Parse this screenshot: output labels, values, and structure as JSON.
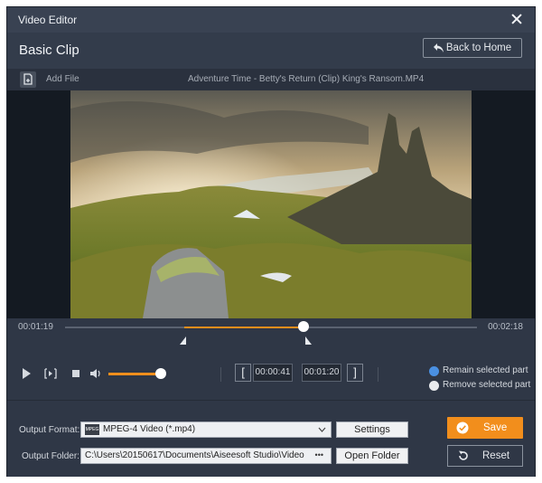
{
  "window": {
    "title": "Video Editor"
  },
  "header": {
    "title": "Basic Clip",
    "back_label": "Back to Home"
  },
  "file_bar": {
    "add_file_label": "Add File",
    "file_name": "Adventure Time - Betty's Return (Clip) King's Ransom.MP4"
  },
  "timeline": {
    "current_time": "00:01:19",
    "end_time": "00:02:18",
    "selection_start_fraction": 0.29,
    "selection_end_fraction": 0.58,
    "playhead_fraction": 0.58
  },
  "controls": {
    "volume_fraction": 0.9,
    "start_time": "00:00:41",
    "end_time": "00:01:20",
    "start_bracket": "[",
    "end_bracket": "]"
  },
  "clip_mode": {
    "options": [
      {
        "label": "Remain selected part",
        "selected": true
      },
      {
        "label": "Remove selected part",
        "selected": false
      }
    ]
  },
  "output": {
    "format_label": "Output Format:",
    "format_value": "MPEG-4 Video (*.mp4)",
    "format_icon_text": "MPEG",
    "settings_label": "Settings",
    "folder_label": "Output Folder:",
    "folder_value": "C:\\Users\\20150617\\Documents\\Aiseesoft Studio\\Video",
    "browse_label": "•••",
    "open_folder_label": "Open Folder",
    "save_label": "Save",
    "reset_label": "Reset"
  },
  "colors": {
    "accent": "#f28e1c",
    "background": "#2f3746",
    "radio_selected": "#4a90e2"
  }
}
